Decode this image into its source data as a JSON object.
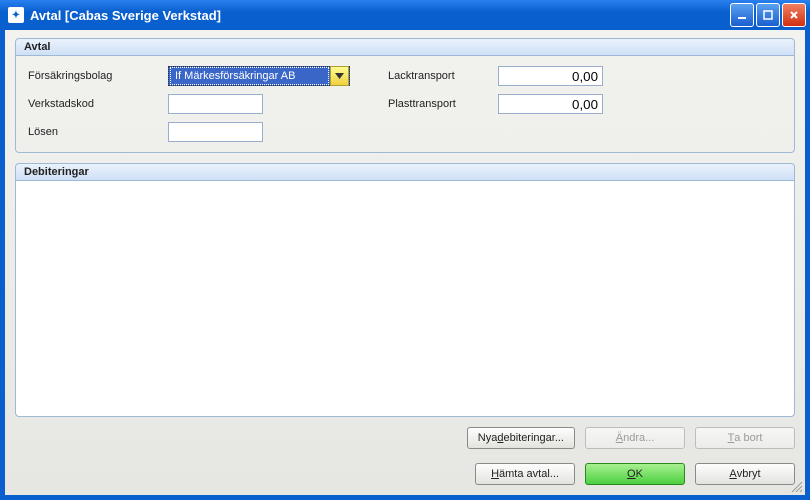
{
  "window": {
    "title": "Avtal [Cabas Sverige Verkstad]"
  },
  "sections": {
    "avtal": {
      "header": "Avtal",
      "insurer_label": "Försäkringsbolag",
      "insurer_value": "If Märkesförsäkringar AB",
      "workshop_code_label": "Verkstadskod",
      "workshop_code_value": "",
      "password_label": "Lösen",
      "password_value": "",
      "lacktransport_label": "Lacktransport",
      "lacktransport_value": "0,00",
      "plasttransport_label": "Plasttransport",
      "plasttransport_value": "0,00"
    },
    "debiteringar": {
      "header": "Debiteringar"
    }
  },
  "buttons": {
    "nya_debiteringar": {
      "pre": "Nya ",
      "u": "d",
      "post": "ebiteringar..."
    },
    "andra": {
      "u": "Ä",
      "post": "ndra..."
    },
    "ta_bort": {
      "u": "T",
      "post": "a bort"
    },
    "hamta_avtal": {
      "u": "H",
      "post": "ämta avtal..."
    },
    "ok": {
      "u": "O",
      "post": "K"
    },
    "avbryt": {
      "u": "A",
      "post": "vbryt"
    }
  }
}
